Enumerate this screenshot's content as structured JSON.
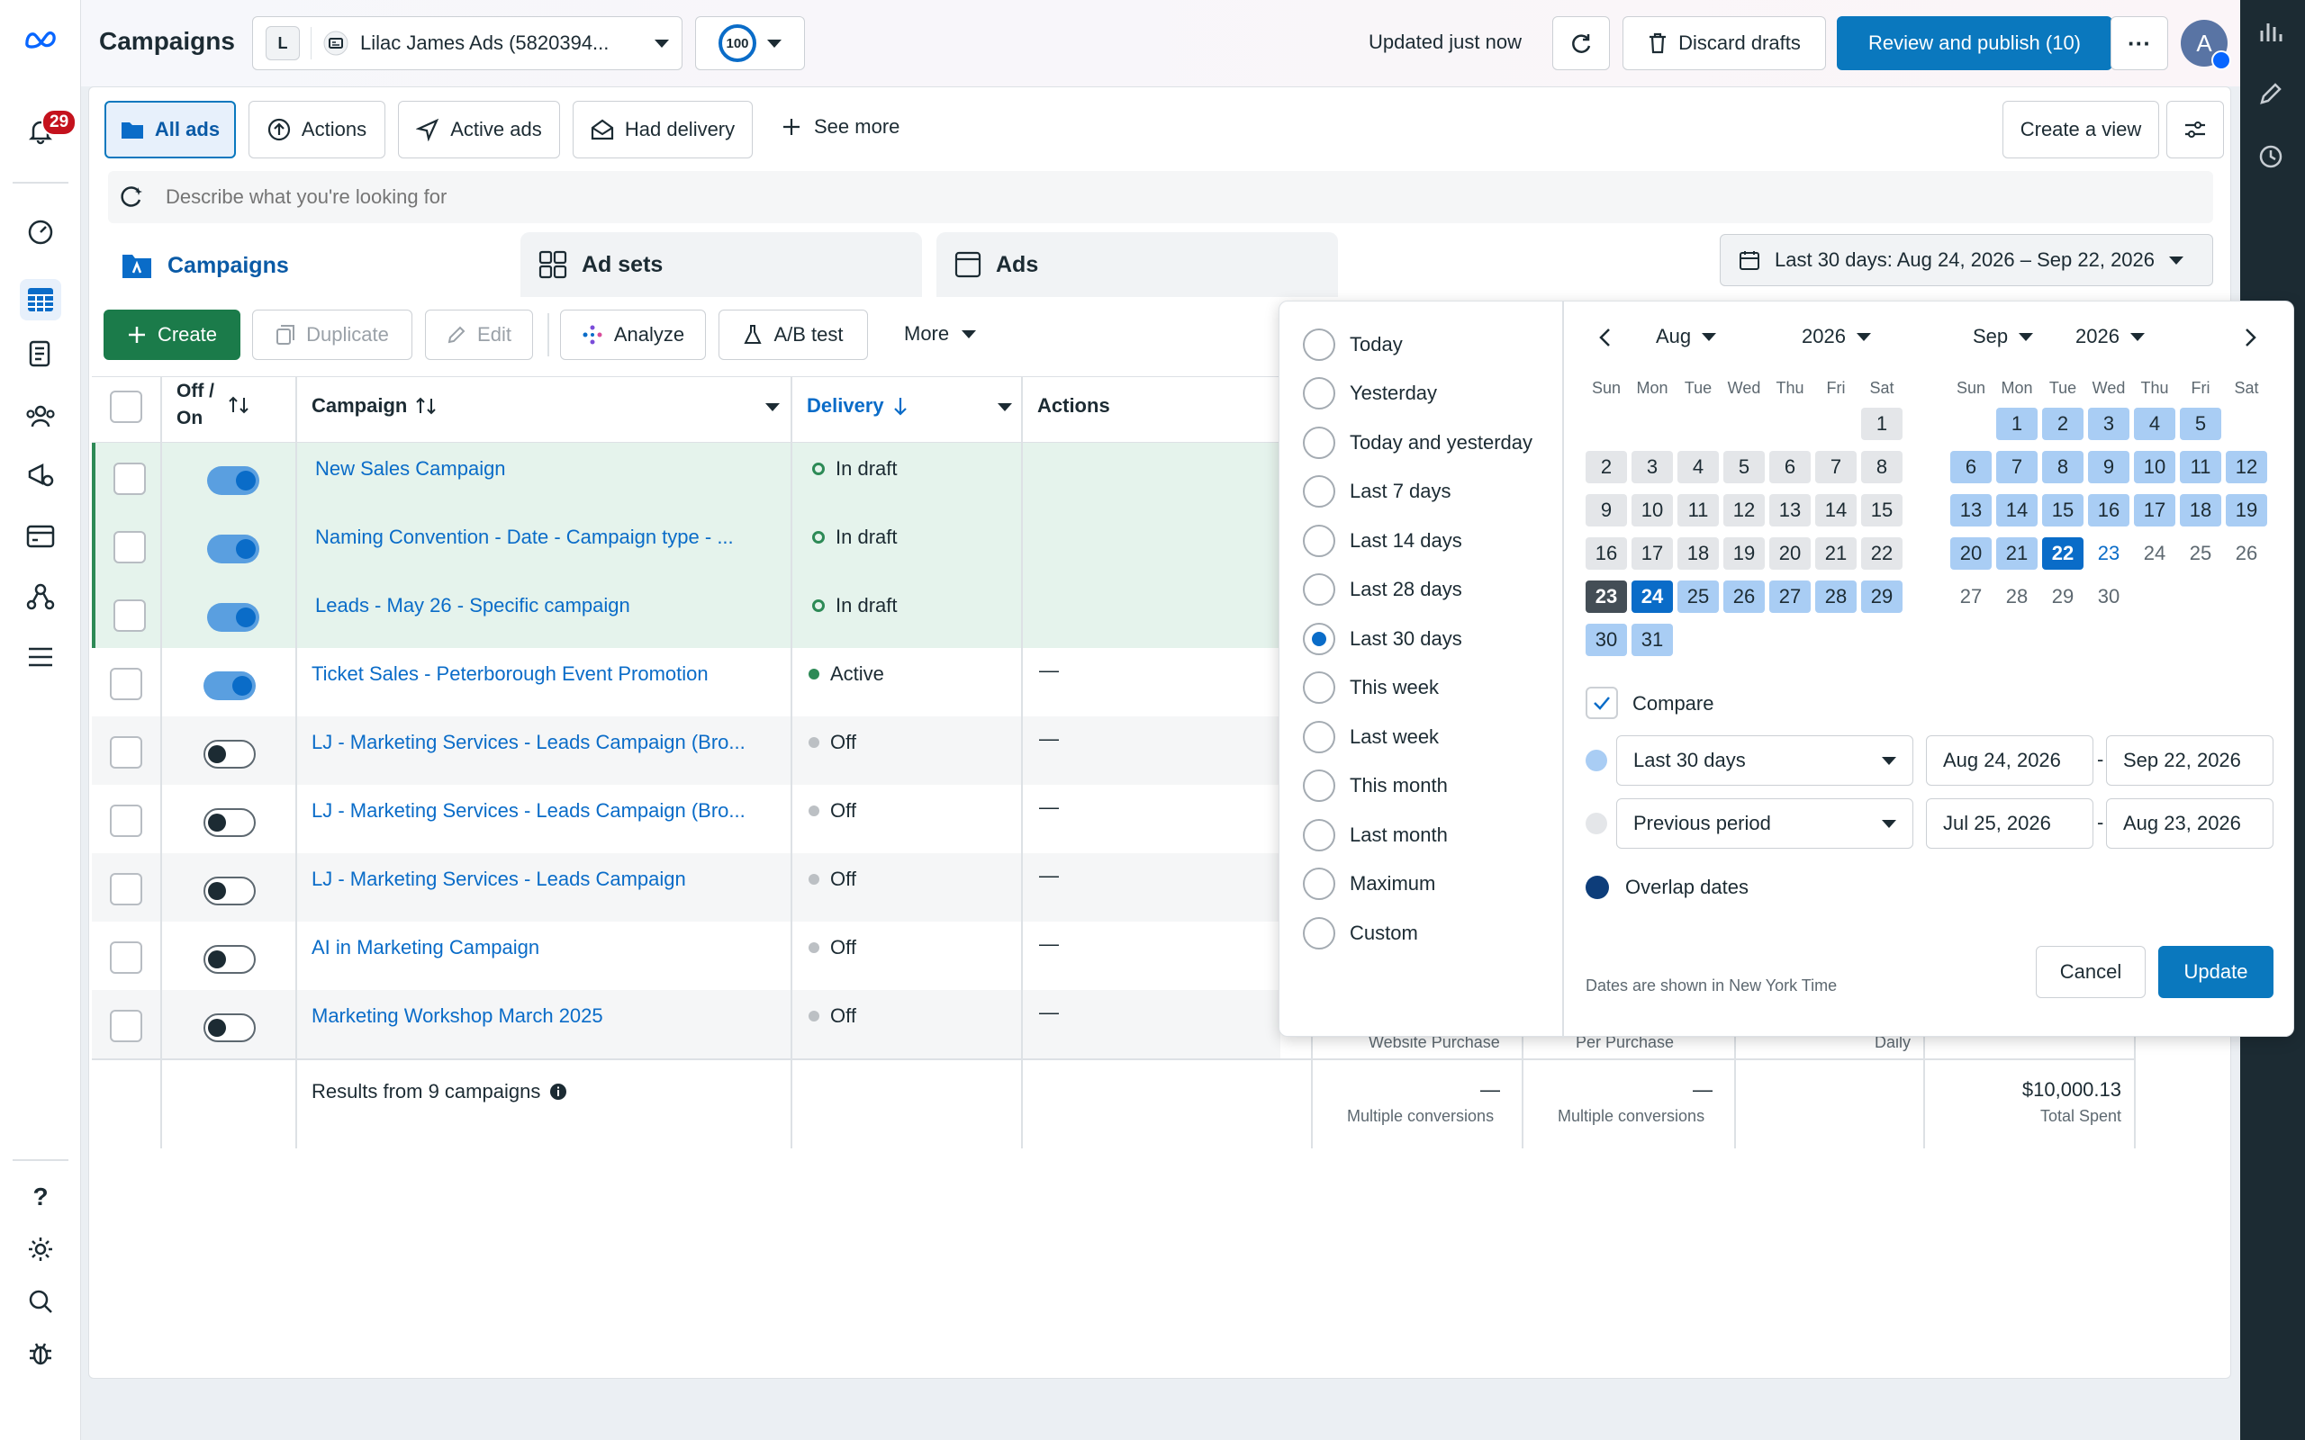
{
  "topbar": {
    "title": "Campaigns",
    "account_initial": "L",
    "account_name": "Lilac James Ads (5820394...",
    "score": "100",
    "updated": "Updated just now",
    "discard": "Discard drafts",
    "publish": "Review and publish (10)",
    "avatar": "A"
  },
  "notifications_count": "29",
  "filters": {
    "all_ads": "All ads",
    "actions": "Actions",
    "active_ads": "Active ads",
    "had_delivery": "Had delivery",
    "see_more": "See more",
    "create_view": "Create a view"
  },
  "search": {
    "placeholder": "Describe what you're looking for"
  },
  "tabs": {
    "campaigns": "Campaigns",
    "adsets": "Ad sets",
    "ads": "Ads"
  },
  "date_button": "Last 30 days: Aug 24, 2026 – Sep 22, 2026",
  "toolbar": {
    "create": "Create",
    "duplicate": "Duplicate",
    "edit": "Edit",
    "analyze": "Analyze",
    "abtest": "A/B test",
    "more": "More"
  },
  "table": {
    "col_off_on": "Off / On",
    "col_campaign": "Campaign",
    "col_delivery": "Delivery",
    "col_actions": "Actions",
    "rows": [
      {
        "name": "New Sales Campaign",
        "delivery": "In draft",
        "action": ""
      },
      {
        "name": "Naming Convention - Date - Campaign type - ...",
        "delivery": "In draft",
        "action": ""
      },
      {
        "name": "Leads - May 26 - Specific campaign",
        "delivery": "In draft",
        "action": ""
      },
      {
        "name": "Ticket Sales - Peterborough Event Promotion",
        "delivery": "Active",
        "action": "—"
      },
      {
        "name": "LJ - Marketing Services - Leads Campaign (Bro...",
        "delivery": "Off",
        "action": "—"
      },
      {
        "name": "LJ - Marketing Services - Leads Campaign (Bro...",
        "delivery": "Off",
        "action": "—"
      },
      {
        "name": "LJ - Marketing Services - Leads Campaign",
        "delivery": "Off",
        "action": "—"
      },
      {
        "name": "AI in Marketing Campaign",
        "delivery": "Off",
        "action": "—"
      },
      {
        "name": "Marketing Workshop March 2025",
        "delivery": "Off",
        "action": "—"
      }
    ],
    "results": "Results from 9 campaigns",
    "hidden_labels": {
      "a": "Website Purchase",
      "b": "Per Purchase",
      "c": "Daily"
    },
    "summary": {
      "dash1": "—",
      "sub1": "Multiple conversions",
      "dash2": "—",
      "sub2": "Multiple conversions",
      "spent": "$10,000.13",
      "spent_label": "Total Spent"
    }
  },
  "datepicker": {
    "presets": [
      "Today",
      "Yesterday",
      "Today and yesterday",
      "Last 7 days",
      "Last 14 days",
      "Last 28 days",
      "Last 30 days",
      "This week",
      "Last week",
      "This month",
      "Last month",
      "Maximum",
      "Custom"
    ],
    "selected_preset": "Last 30 days",
    "left_month": "Aug",
    "left_year": "2026",
    "right_month": "Sep",
    "right_year": "2026",
    "weekdays": [
      "Sun",
      "Mon",
      "Tue",
      "Wed",
      "Thu",
      "Fri",
      "Sat"
    ],
    "compare": "Compare",
    "range1_preset": "Last 30 days",
    "range1_start": "Aug 24, 2026",
    "range1_end": "Sep 22, 2026",
    "range2_preset": "Previous period",
    "range2_start": "Jul 25, 2026",
    "range2_end": "Aug 23, 2026",
    "overlap": "Overlap dates",
    "timezone_note": "Dates are shown in New York Time",
    "cancel": "Cancel",
    "update": "Update",
    "dash": "-"
  },
  "help": "?"
}
